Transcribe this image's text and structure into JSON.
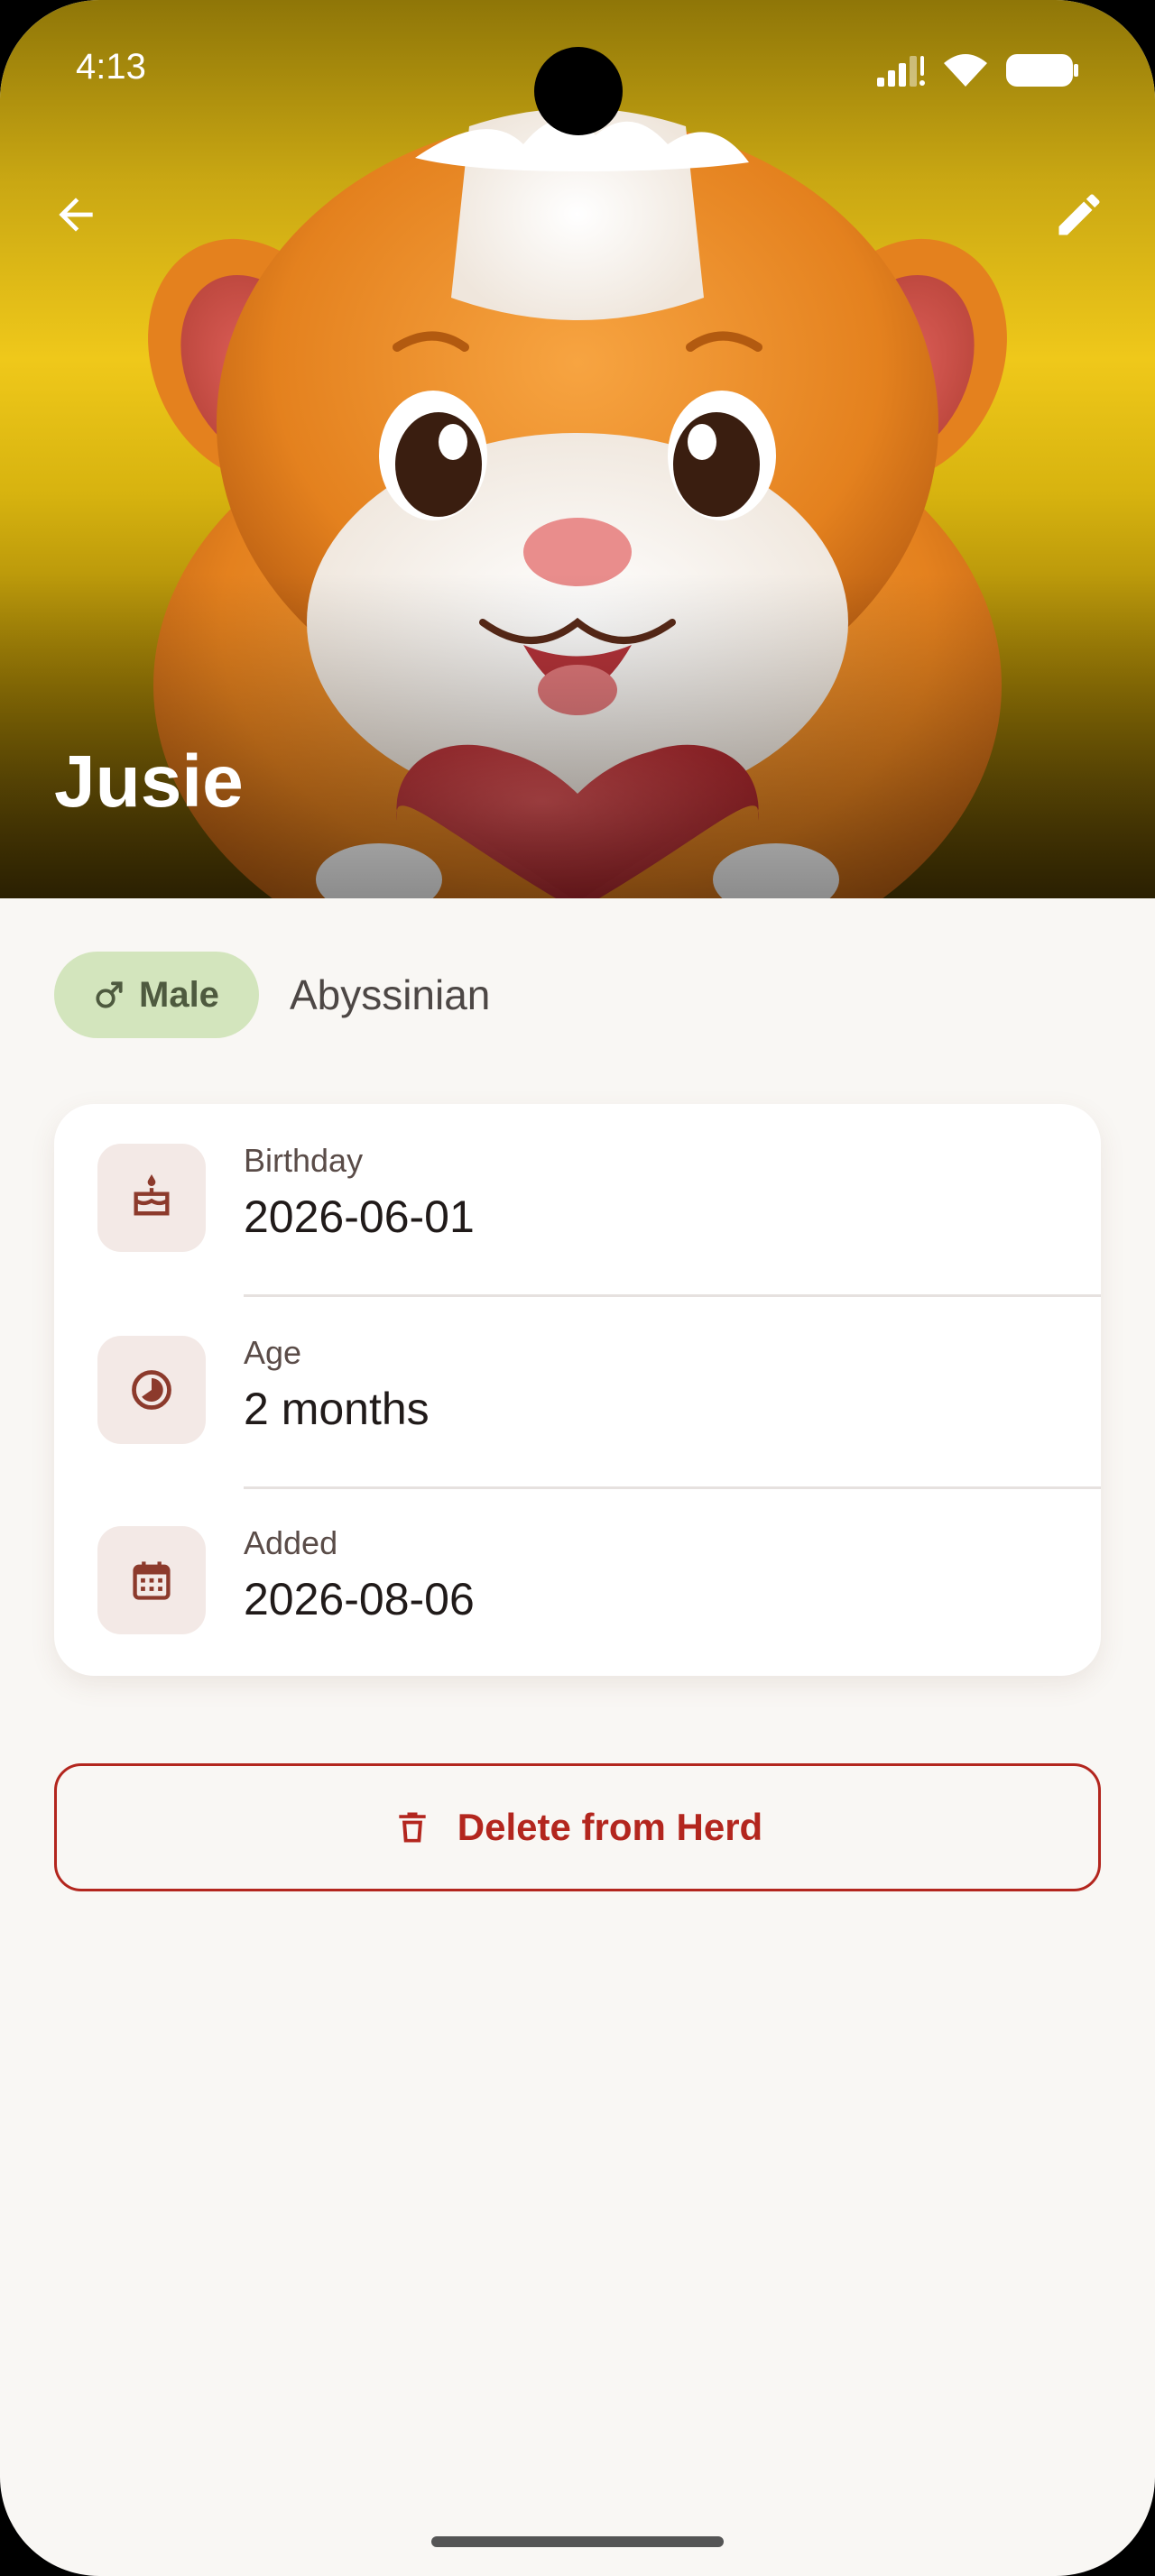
{
  "status_bar": {
    "time": "4:13"
  },
  "hero": {
    "pet_name": "Jusie",
    "back_icon": "arrow-back-icon",
    "edit_icon": "pencil-icon"
  },
  "profile": {
    "gender": {
      "symbol": "♂",
      "label": "Male"
    },
    "breed": "Abyssinian"
  },
  "info_card": {
    "rows": [
      {
        "icon": "cake-icon",
        "label": "Birthday",
        "value": "2026-06-01"
      },
      {
        "icon": "age-icon",
        "label": "Age",
        "value": "2 months"
      },
      {
        "icon": "calendar-icon",
        "label": "Added",
        "value": "2026-08-06"
      }
    ]
  },
  "actions": {
    "delete_label": "Delete from Herd",
    "delete_icon": "trash-icon"
  },
  "colors": {
    "primary_red": "#b3261e",
    "chip_green": "#d3e5bd",
    "background": "#f9f7f4",
    "icon_brown": "#8c3a2c"
  }
}
